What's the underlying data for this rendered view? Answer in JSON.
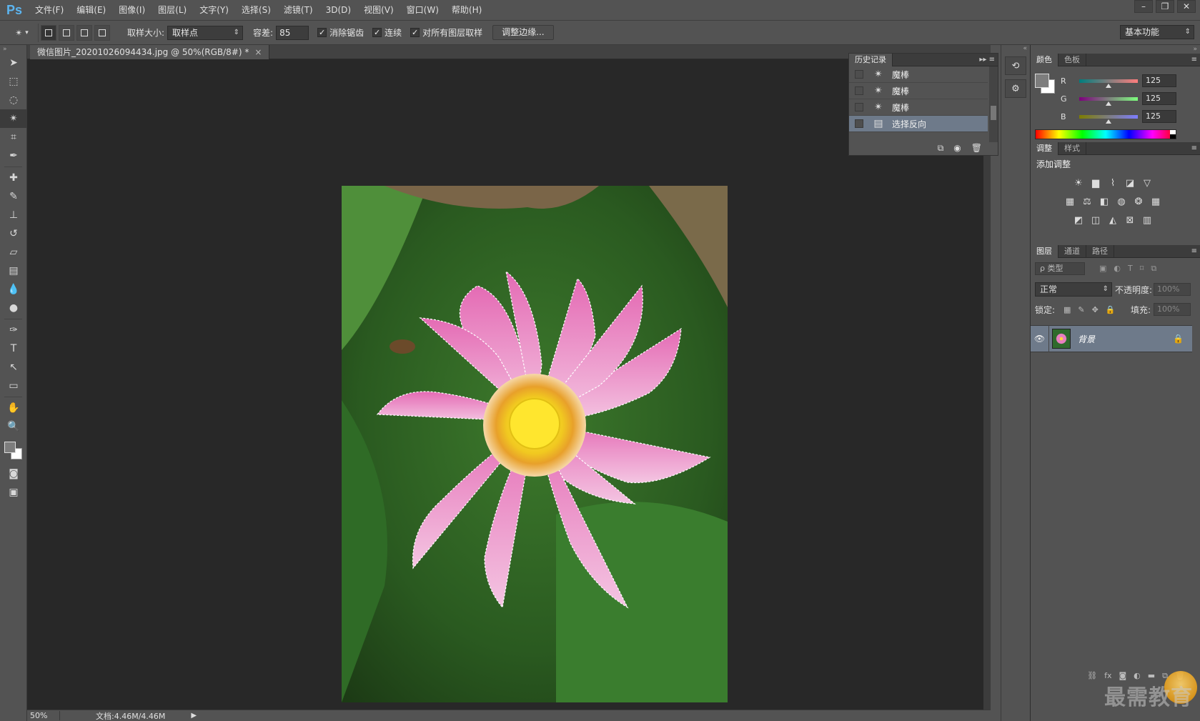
{
  "app": {
    "logo": "Ps"
  },
  "menu": [
    "文件(F)",
    "编辑(E)",
    "图像(I)",
    "图层(L)",
    "文字(Y)",
    "选择(S)",
    "滤镜(T)",
    "3D(D)",
    "视图(V)",
    "窗口(W)",
    "帮助(H)"
  ],
  "window_controls": {
    "minimize": "–",
    "restore": "❐",
    "close": "✕"
  },
  "options": {
    "sample_size_label": "取样大小:",
    "sample_size_value": "取样点",
    "tolerance_label": "容差:",
    "tolerance_value": "85",
    "antialias_label": "消除锯齿",
    "contiguous_label": "连续",
    "all_layers_label": "对所有图层取样",
    "refine_edge_label": "调整边缘...",
    "workspace": "基本功能",
    "checks": {
      "antialias": true,
      "contiguous": true,
      "all_layers": true
    }
  },
  "document": {
    "tab_title": "微信图片_20201026094434.jpg @ 50%(RGB/8#) *",
    "zoom": "50%",
    "doc_info": "文档:4.46M/4.46M"
  },
  "history": {
    "tab": "历史记录",
    "items": [
      {
        "label": "魔棒",
        "icon": "magic-wand-icon",
        "selected": false
      },
      {
        "label": "魔棒",
        "icon": "magic-wand-icon",
        "selected": false
      },
      {
        "label": "魔棒",
        "icon": "magic-wand-icon",
        "selected": false
      },
      {
        "label": "选择反向",
        "icon": "document-icon",
        "selected": true
      }
    ]
  },
  "color_panel": {
    "tabs": [
      "颜色",
      "色板"
    ],
    "r_label": "R",
    "r_value": "125",
    "g_label": "G",
    "g_value": "125",
    "b_label": "B",
    "b_value": "125",
    "fg_color": "#7d7d7d",
    "bg_color": "#ffffff"
  },
  "adjustments_panel": {
    "tabs": [
      "调整",
      "样式"
    ],
    "title": "添加调整"
  },
  "layers_panel": {
    "tabs": [
      "图层",
      "通道",
      "路径"
    ],
    "filter_type": "ρ 类型",
    "blend_mode": "正常",
    "opacity_label": "不透明度:",
    "opacity_value": "100%",
    "lock_label": "锁定:",
    "fill_label": "填充:",
    "fill_value": "100%",
    "layer_name": "背景"
  },
  "watermark": "最需教育"
}
